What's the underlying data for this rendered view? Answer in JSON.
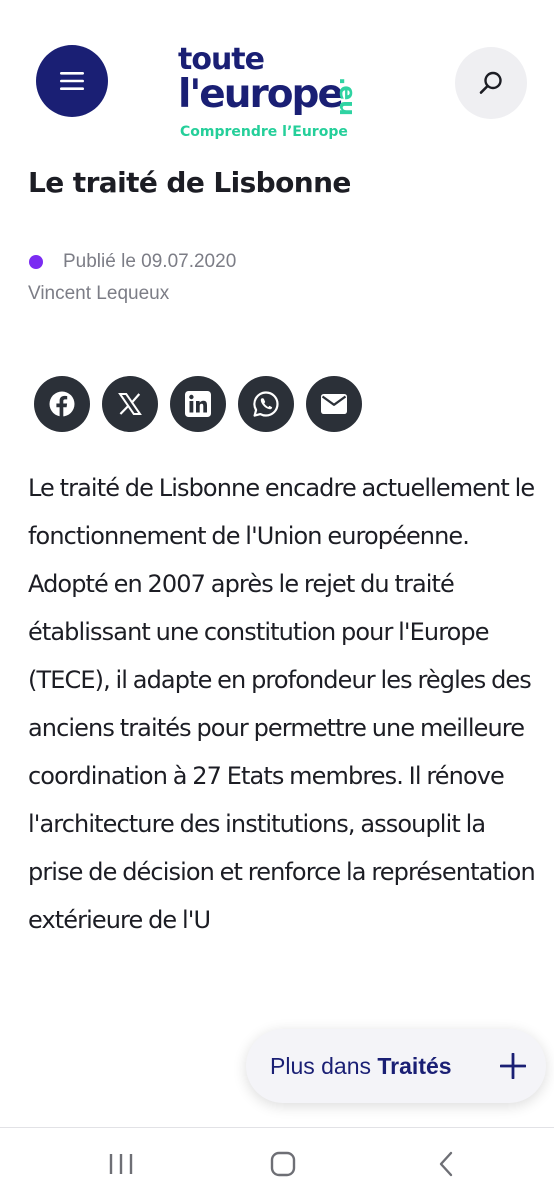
{
  "header": {
    "logo_line1": "toute",
    "logo_line2": "l'europe",
    "logo_suffix": ".eu",
    "tagline": "Comprendre l’Europe",
    "brand_color": "#1a1f74",
    "accent_color": "#2fd3a2",
    "menu_icon": "hamburger-icon",
    "search_icon": "search-icon"
  },
  "article": {
    "title": "Le traité de Lisbonne",
    "published": "Publié le 09.07.2020",
    "author": "Vincent Lequeux",
    "dot_color": "#7b2cf2",
    "body": "Le traité de Lisbonne encadre actuellement le fonctionnement de l'Union européenne. Adopté en 2007 après le rejet du traité établissant une constitution pour l'Europe (TECE), il adapte en profondeur les règles des anciens traités pour permettre une meilleure coordination à 27 Etats membres. Il rénove l'architecture des institutions, assouplit la prise de décision et renforce la représentation extérieure de l'U"
  },
  "share": [
    {
      "icon": "facebook-icon"
    },
    {
      "icon": "x-twitter-icon"
    },
    {
      "icon": "linkedin-icon"
    },
    {
      "icon": "whatsapp-icon"
    },
    {
      "icon": "email-icon"
    }
  ],
  "more_pill": {
    "prefix": "Plus dans ",
    "topic": "Traités",
    "icon": "plus-icon"
  },
  "navbar": {
    "recents_icon": "recent-apps-icon",
    "home_icon": "home-icon",
    "back_icon": "back-icon"
  }
}
